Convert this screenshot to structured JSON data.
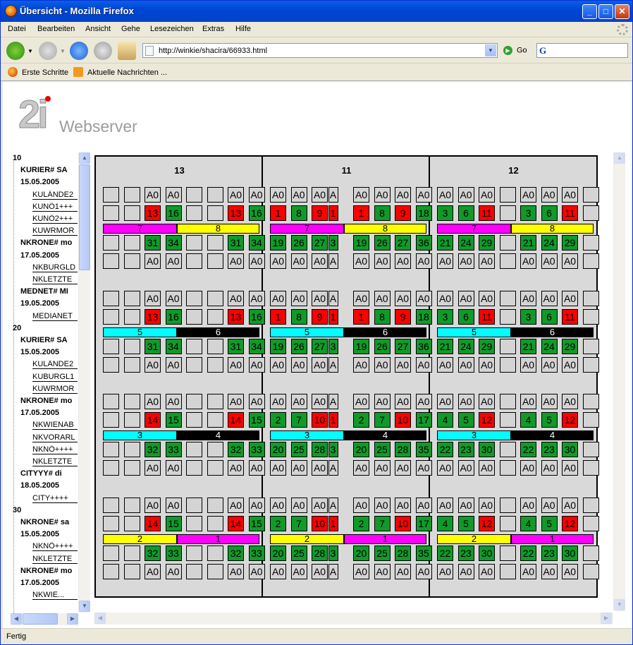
{
  "window": {
    "title": "Übersicht - Mozilla Firefox"
  },
  "menu": [
    "Datei",
    "Bearbeiten",
    "Ansicht",
    "Gehe",
    "Lesezeichen",
    "Extras",
    "Hilfe"
  ],
  "nav": {
    "url": "http://winkie/shacira/66933.html",
    "go_label": "Go",
    "search_placeholder": ""
  },
  "bookmarks": [
    "Erste Schritte",
    "Aktuelle Nachrichten ..."
  ],
  "logo": {
    "mark": "2i",
    "text": "Webserver"
  },
  "status": "Fertig",
  "sidebar": [
    {
      "t": "10",
      "k": "h"
    },
    {
      "t": "KURIER# SA",
      "k": "b"
    },
    {
      "t": "15.05.2005",
      "k": "b"
    },
    {
      "t": "KULÄNDE2",
      "k": "n"
    },
    {
      "t": "KUNÖ1+++",
      "k": "n"
    },
    {
      "t": "KUNÖ2+++",
      "k": "n"
    },
    {
      "t": "KUWRMOR",
      "k": "n"
    },
    {
      "t": "NKRONE# mo",
      "k": "b"
    },
    {
      "t": "17.05.2005",
      "k": "b"
    },
    {
      "t": "NKBURGLD",
      "k": "n"
    },
    {
      "t": "NKLETZTE",
      "k": "n"
    },
    {
      "t": "MEDNET# MI",
      "k": "b"
    },
    {
      "t": "19.05.2005",
      "k": "b"
    },
    {
      "t": "MEDIANET",
      "k": "n"
    },
    {
      "t": "20",
      "k": "h"
    },
    {
      "t": "KURIER# SA",
      "k": "b"
    },
    {
      "t": "15.05.2005",
      "k": "b"
    },
    {
      "t": "KULÄNDE2",
      "k": "n"
    },
    {
      "t": "KUBURGL1",
      "k": "n"
    },
    {
      "t": "KUWRMOR",
      "k": "n"
    },
    {
      "t": "NKRONE# mo",
      "k": "b"
    },
    {
      "t": "17.05.2005",
      "k": "b"
    },
    {
      "t": "NKWIENAB",
      "k": "n"
    },
    {
      "t": "NKVORARL",
      "k": "n"
    },
    {
      "t": "NKNÖ++++",
      "k": "n"
    },
    {
      "t": "NKLETZTE",
      "k": "n"
    },
    {
      "t": "CITYYY# di",
      "k": "b"
    },
    {
      "t": "18.05.2005",
      "k": "b"
    },
    {
      "t": "CITY++++",
      "k": "n"
    },
    {
      "t": "30",
      "k": "h"
    },
    {
      "t": "NKRONE# sa",
      "k": "b"
    },
    {
      "t": "15.05.2005",
      "k": "b"
    },
    {
      "t": "NKNÖ++++",
      "k": "n"
    },
    {
      "t": "NKLETZTE",
      "k": "n"
    },
    {
      "t": "NKRONE# mo",
      "k": "b"
    },
    {
      "t": "17.05.2005",
      "k": "b"
    },
    {
      "t": "NKWIE...",
      "k": "n"
    }
  ],
  "colors": {
    "green": "#119A2A",
    "red": "#FF0000",
    "magenta": "#FF00FF",
    "yellow": "#FFFF00",
    "cyan": "#00FFFF",
    "black": "#000000",
    "gray": "#D4D4D4"
  },
  "columns": [
    {
      "title": "13",
      "blocks": [
        {
          "r1": [
            "",
            "",
            "A0",
            "A0",
            "",
            "",
            "A0",
            "A0"
          ],
          "r2": [
            "",
            "",
            "13",
            "16",
            "",
            "",
            "13",
            "16"
          ],
          "bar": [
            {
              "label": "7",
              "color": "magenta"
            },
            {
              "label": "8",
              "color": "yellow"
            }
          ],
          "r3": [
            "",
            "",
            "31",
            "34",
            "",
            "",
            "31",
            "34"
          ],
          "r4": [
            "",
            "",
            "A0",
            "A0",
            "",
            "",
            "A0",
            "A0"
          ]
        },
        {
          "r1": [
            "",
            "",
            "A0",
            "A0",
            "",
            "",
            "A0",
            "A0"
          ],
          "r2": [
            "",
            "",
            "13",
            "16",
            "",
            "",
            "13",
            "16"
          ],
          "bar": [
            {
              "label": "5",
              "color": "cyan"
            },
            {
              "label": "6",
              "color": "black"
            }
          ],
          "r3": [
            "",
            "",
            "31",
            "34",
            "",
            "",
            "31",
            "34"
          ],
          "r4": [
            "",
            "",
            "A0",
            "A0",
            "",
            "",
            "A0",
            "A0"
          ]
        },
        {
          "r1": [
            "",
            "",
            "A0",
            "A0",
            "",
            "",
            "A0",
            "A0"
          ],
          "r2": [
            "",
            "",
            "14",
            "15",
            "",
            "",
            "14",
            "15"
          ],
          "bar": [
            {
              "label": "3",
              "color": "cyan"
            },
            {
              "label": "4",
              "color": "black"
            }
          ],
          "r3": [
            "",
            "",
            "32",
            "33",
            "",
            "",
            "32",
            "33"
          ],
          "r4": [
            "",
            "",
            "A0",
            "A0",
            "",
            "",
            "A0",
            "A0"
          ]
        },
        {
          "r1": [
            "",
            "",
            "A0",
            "A0",
            "",
            "",
            "A0",
            "A0"
          ],
          "r2": [
            "",
            "",
            "14",
            "15",
            "",
            "",
            "14",
            "15"
          ],
          "bar": [
            {
              "label": "2",
              "color": "yellow"
            },
            {
              "label": "1",
              "color": "magenta"
            }
          ],
          "r3": [
            "",
            "",
            "32",
            "33",
            "",
            "",
            "32",
            "33"
          ],
          "r4": [
            "",
            "",
            "A0",
            "A0",
            "",
            "",
            "A0",
            "A0"
          ]
        }
      ]
    },
    {
      "title": "11",
      "blocks": [
        {
          "r1": [
            "A0",
            "A0",
            "A0",
            "A",
            "A0",
            "A0",
            "A0",
            "A0"
          ],
          "r2": [
            "1",
            "8",
            "9",
            "1",
            "1",
            "8",
            "9",
            "18"
          ],
          "bar": [
            {
              "label": "7",
              "color": "magenta"
            },
            {
              "label": "8",
              "color": "yellow"
            }
          ],
          "r3": [
            "19",
            "26",
            "27",
            "3",
            "19",
            "26",
            "27",
            "36"
          ],
          "r4": [
            "A0",
            "A0",
            "A0",
            "A",
            "A0",
            "A0",
            "A0",
            "A0"
          ]
        },
        {
          "r1": [
            "A0",
            "A0",
            "A0",
            "A",
            "A0",
            "A0",
            "A0",
            "A0"
          ],
          "r2": [
            "1",
            "8",
            "9",
            "1",
            "1",
            "8",
            "9",
            "18"
          ],
          "bar": [
            {
              "label": "5",
              "color": "cyan"
            },
            {
              "label": "6",
              "color": "black"
            }
          ],
          "r3": [
            "19",
            "26",
            "27",
            "3",
            "19",
            "26",
            "27",
            "36"
          ],
          "r4": [
            "A0",
            "A0",
            "A0",
            "A",
            "A0",
            "A0",
            "A0",
            "A0"
          ]
        },
        {
          "r1": [
            "A0",
            "A0",
            "A0",
            "A",
            "A0",
            "A0",
            "A0",
            "A0"
          ],
          "r2": [
            "2",
            "7",
            "10",
            "1",
            "2",
            "7",
            "10",
            "17"
          ],
          "bar": [
            {
              "label": "3",
              "color": "cyan"
            },
            {
              "label": "4",
              "color": "black"
            }
          ],
          "r3": [
            "20",
            "25",
            "28",
            "3",
            "20",
            "25",
            "28",
            "35"
          ],
          "r4": [
            "A0",
            "A0",
            "A0",
            "A",
            "A0",
            "A0",
            "A0",
            "A0"
          ]
        },
        {
          "r1": [
            "A0",
            "A0",
            "A0",
            "A",
            "A0",
            "A0",
            "A0",
            "A0"
          ],
          "r2": [
            "2",
            "7",
            "10",
            "1",
            "2",
            "7",
            "10",
            "17"
          ],
          "bar": [
            {
              "label": "2",
              "color": "yellow"
            },
            {
              "label": "1",
              "color": "magenta"
            }
          ],
          "r3": [
            "20",
            "25",
            "28",
            "3",
            "20",
            "25",
            "28",
            "35"
          ],
          "r4": [
            "A0",
            "A0",
            "A0",
            "A",
            "A0",
            "A0",
            "A0",
            "A0"
          ]
        }
      ]
    },
    {
      "title": "12",
      "blocks": [
        {
          "r1": [
            "A0",
            "A0",
            "A0",
            "",
            "A0",
            "A0",
            "A0",
            ""
          ],
          "r2": [
            "3",
            "6",
            "11",
            "",
            "3",
            "6",
            "11",
            ""
          ],
          "bar": [
            {
              "label": "7",
              "color": "magenta"
            },
            {
              "label": "8",
              "color": "yellow"
            }
          ],
          "r3": [
            "21",
            "24",
            "29",
            "",
            "21",
            "24",
            "29",
            ""
          ],
          "r4": [
            "A0",
            "A0",
            "A0",
            "",
            "A0",
            "A0",
            "A0",
            ""
          ]
        },
        {
          "r1": [
            "A0",
            "A0",
            "A0",
            "",
            "A0",
            "A0",
            "A0",
            ""
          ],
          "r2": [
            "3",
            "6",
            "11",
            "",
            "3",
            "6",
            "11",
            ""
          ],
          "bar": [
            {
              "label": "5",
              "color": "cyan"
            },
            {
              "label": "6",
              "color": "black"
            }
          ],
          "r3": [
            "21",
            "24",
            "29",
            "",
            "21",
            "24",
            "29",
            ""
          ],
          "r4": [
            "A0",
            "A0",
            "A0",
            "",
            "A0",
            "A0",
            "A0",
            ""
          ]
        },
        {
          "r1": [
            "A0",
            "A0",
            "A0",
            "",
            "A0",
            "A0",
            "A0",
            ""
          ],
          "r2": [
            "4",
            "5",
            "12",
            "",
            "4",
            "5",
            "12",
            ""
          ],
          "bar": [
            {
              "label": "3",
              "color": "cyan"
            },
            {
              "label": "4",
              "color": "black"
            }
          ],
          "r3": [
            "22",
            "23",
            "30",
            "",
            "22",
            "23",
            "30",
            ""
          ],
          "r4": [
            "A0",
            "A0",
            "A0",
            "",
            "A0",
            "A0",
            "A0",
            ""
          ]
        },
        {
          "r1": [
            "A0",
            "A0",
            "A0",
            "",
            "A0",
            "A0",
            "A0",
            ""
          ],
          "r2": [
            "4",
            "5",
            "12",
            "",
            "4",
            "5",
            "12",
            ""
          ],
          "bar": [
            {
              "label": "2",
              "color": "yellow"
            },
            {
              "label": "1",
              "color": "magenta"
            }
          ],
          "r3": [
            "22",
            "23",
            "30",
            "",
            "22",
            "23",
            "30",
            ""
          ],
          "r4": [
            "A0",
            "A0",
            "A0",
            "",
            "A0",
            "A0",
            "A0",
            ""
          ]
        }
      ]
    }
  ],
  "red_cells": {
    "13": [
      "13",
      "14"
    ],
    "11": [
      "1",
      "9",
      "10"
    ],
    "12": [
      "11",
      "12"
    ]
  }
}
